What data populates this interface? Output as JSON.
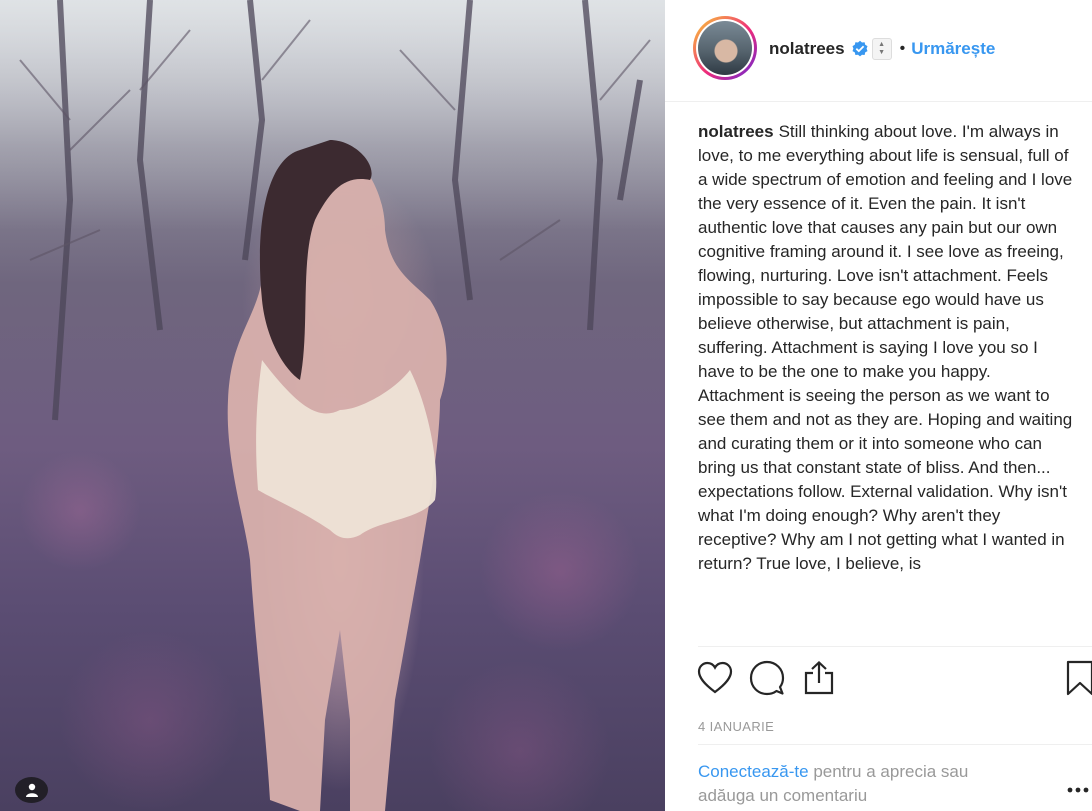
{
  "post": {
    "username": "nolatrees",
    "follow_label": "Urmărește",
    "separator": "•",
    "caption_username": "nolatrees",
    "caption_text": "Still thinking about love. I'm always in love, to me everything about life is sensual, full of a wide spectrum of emotion and feeling and I love the very essence of it. Even the pain. It isn't authentic love that causes any pain but our own cognitive framing around it. I see love as freeing, flowing, nurturing. Love isn't attachment. Feels impossible to say because ego would have us believe otherwise, but attachment is pain, suffering. Attachment is saying I love you so I have to be the one to make you happy. Attachment is seeing the person as we want to see them and not as they are. Hoping and waiting and curating them or it into someone who can bring us that constant state of bliss. And then... expectations follow. External validation. Why isn't what I'm doing enough? Why aren't they receptive? Why am I not getting what I wanted in return? True love, I believe, is",
    "date": "4 IANUARIE",
    "login_link": "Conectează-te",
    "login_text": "pentru a aprecia sau adăuga un comentariu"
  },
  "icons": {
    "verified": "verified-badge-icon",
    "like": "heart-icon",
    "comment": "comment-bubble-icon",
    "share": "share-icon",
    "save": "bookmark-icon",
    "more": "more-options-icon",
    "tagged_user": "user-tag-icon"
  },
  "colors": {
    "accent": "#3897f0",
    "text": "#262626",
    "muted": "#999999",
    "divider": "#efefef"
  }
}
